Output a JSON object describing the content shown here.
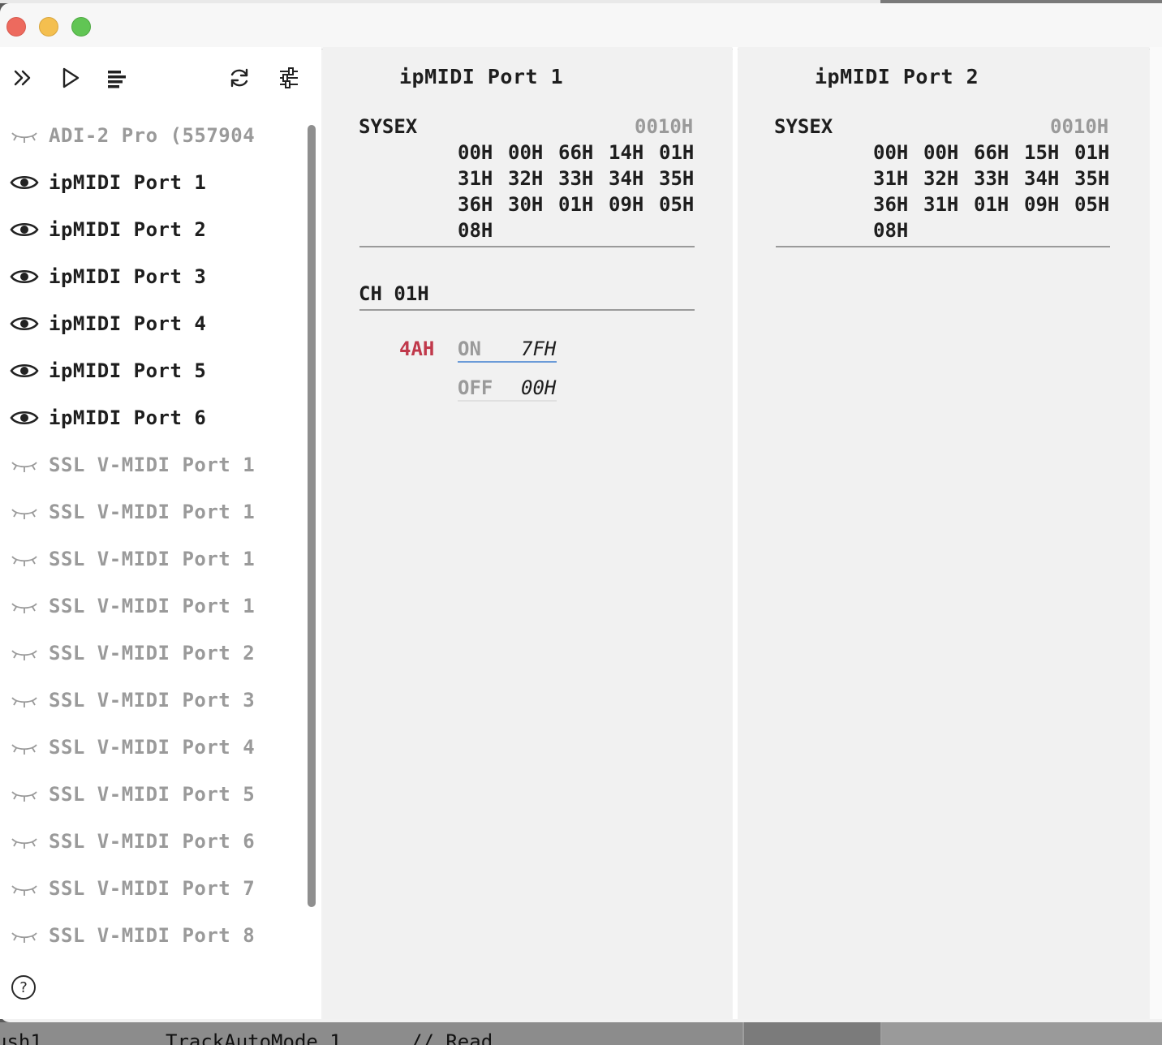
{
  "window": {
    "traffic_lights": [
      "close",
      "minimize",
      "zoom"
    ]
  },
  "toolbar": {
    "buttons": [
      {
        "name": "expand",
        "icon": "double-chevron-right-icon"
      },
      {
        "name": "play",
        "icon": "play-icon"
      },
      {
        "name": "list",
        "icon": "text-align-left-icon"
      },
      {
        "name": "refresh",
        "icon": "refresh-icon"
      },
      {
        "name": "settings",
        "icon": "sliders-icon"
      }
    ]
  },
  "sidebar": {
    "ports": [
      {
        "label": "ADI-2 Pro (557904",
        "active": false
      },
      {
        "label": "ipMIDI Port 1",
        "active": true
      },
      {
        "label": "ipMIDI Port 2",
        "active": true
      },
      {
        "label": "ipMIDI Port 3",
        "active": true
      },
      {
        "label": "ipMIDI Port 4",
        "active": true
      },
      {
        "label": "ipMIDI Port 5",
        "active": true
      },
      {
        "label": "ipMIDI Port 6",
        "active": true
      },
      {
        "label": "SSL V-MIDI Port 1",
        "active": false
      },
      {
        "label": "SSL V-MIDI Port 1",
        "active": false
      },
      {
        "label": "SSL V-MIDI Port 1",
        "active": false
      },
      {
        "label": "SSL V-MIDI Port 1",
        "active": false
      },
      {
        "label": "SSL V-MIDI Port 2",
        "active": false
      },
      {
        "label": "SSL V-MIDI Port 3",
        "active": false
      },
      {
        "label": "SSL V-MIDI Port 4",
        "active": false
      },
      {
        "label": "SSL V-MIDI Port 5",
        "active": false
      },
      {
        "label": "SSL V-MIDI Port 6",
        "active": false
      },
      {
        "label": "SSL V-MIDI Port 7",
        "active": false
      },
      {
        "label": "SSL V-MIDI Port 8",
        "active": false
      }
    ],
    "help_label": "?"
  },
  "panels": [
    {
      "title": "ipMIDI Port 1",
      "sysex": {
        "label": "SYSEX",
        "address": "0010H",
        "rows": [
          [
            "00H",
            "00H",
            "66H",
            "14H",
            "01H"
          ],
          [
            "31H",
            "32H",
            "33H",
            "34H",
            "35H"
          ],
          [
            "36H",
            "30H",
            "01H",
            "09H",
            "05H"
          ],
          [
            "08H"
          ]
        ]
      },
      "channel": {
        "label": "CH 01H",
        "note": "4AH",
        "on_label": "ON",
        "on_value": "7FH",
        "off_label": "OFF",
        "off_value": "00H"
      }
    },
    {
      "title": "ipMIDI Port 2",
      "sysex": {
        "label": "SYSEX",
        "address": "0010H",
        "rows": [
          [
            "00H",
            "00H",
            "66H",
            "15H",
            "01H"
          ],
          [
            "31H",
            "32H",
            "33H",
            "34H",
            "35H"
          ],
          [
            "36H",
            "31H",
            "01H",
            "09H",
            "05H"
          ],
          [
            "08H"
          ]
        ]
      }
    }
  ],
  "background_window": {
    "texts": [
      "ush1",
      "TrackAutoMode 1",
      "// Read"
    ]
  },
  "colors": {
    "note": "#c0394b",
    "on_underline": "#6b9bd8",
    "inactive_text": "#9a9a9a"
  }
}
